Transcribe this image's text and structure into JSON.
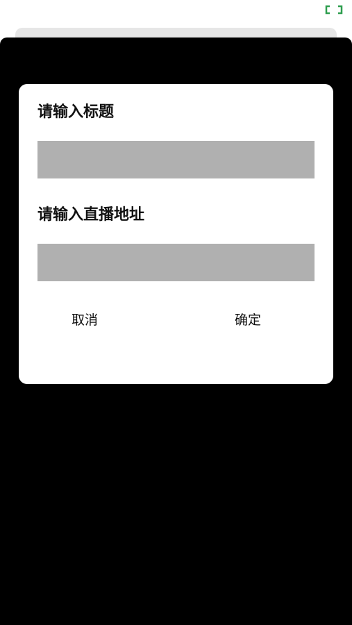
{
  "dialog": {
    "title_label": "请输入标题",
    "title_value": "",
    "url_label": "请输入直播地址",
    "url_value": "",
    "cancel_label": "取消",
    "confirm_label": "确定"
  },
  "icons": {
    "top_right": "expand-icon"
  },
  "colors": {
    "overlay": "#000000",
    "dialog_bg": "#ffffff",
    "input_bg": "#b0b0b0",
    "icon_accent": "#2e9e4f"
  }
}
